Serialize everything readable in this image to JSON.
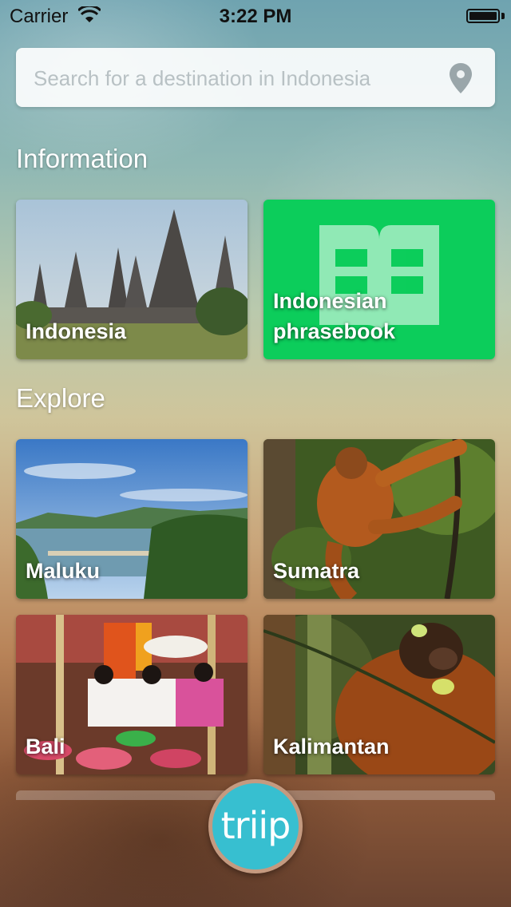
{
  "status_bar": {
    "carrier": "Carrier",
    "time": "3:22 PM"
  },
  "search": {
    "placeholder": "Search for a destination in Indonesia",
    "value": "",
    "icon": "location-pin-icon"
  },
  "information": {
    "title": "Information",
    "items": [
      {
        "label": "Indonesia",
        "image": "temple-photo"
      },
      {
        "label": "Indonesian\nphrasebook",
        "icon": "book-icon",
        "color": "#0ccd5b"
      }
    ]
  },
  "explore": {
    "title": "Explore",
    "items": [
      {
        "label": "Maluku",
        "image": "coast-photo"
      },
      {
        "label": "Sumatra",
        "image": "orangutan-photo"
      },
      {
        "label": "Bali",
        "image": "festival-photo"
      },
      {
        "label": "Kalimantan",
        "image": "orangutan-closeup-photo"
      }
    ]
  },
  "logo": {
    "text": "triip",
    "color": "#37bfd0"
  }
}
